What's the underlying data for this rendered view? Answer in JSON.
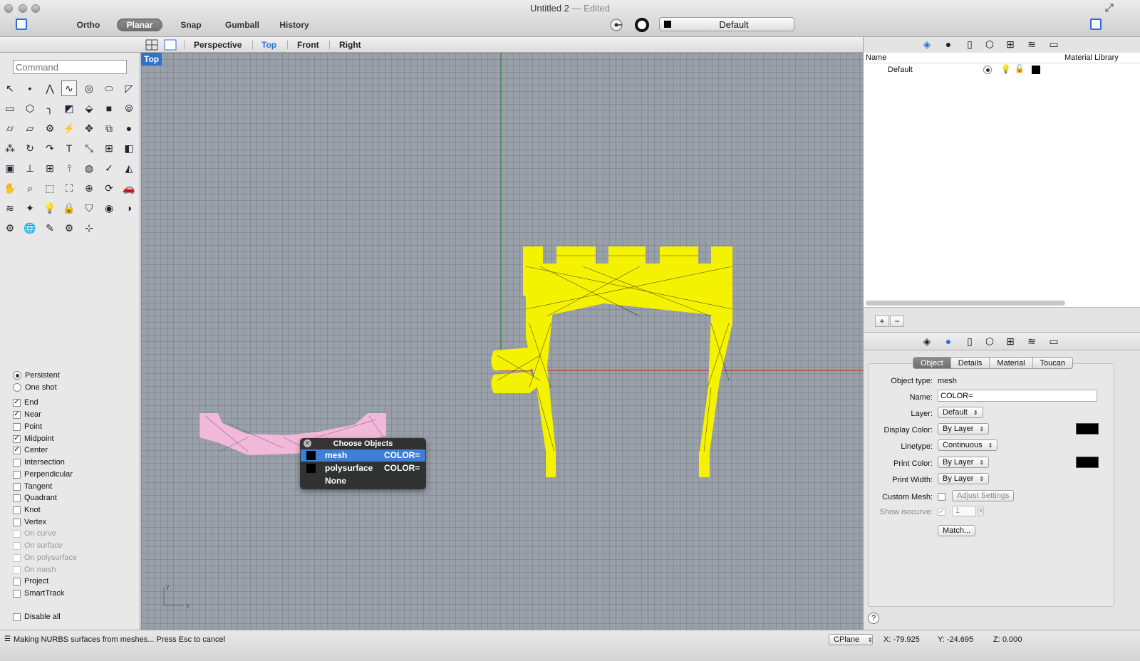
{
  "window": {
    "title": "Untitled 2",
    "edited": "— Edited"
  },
  "toolbar": {
    "ortho": "Ortho",
    "planar": "Planar",
    "snap": "Snap",
    "gumball": "Gumball",
    "history": "History",
    "layer": "Default"
  },
  "viewport_tabs": {
    "perspective": "Perspective",
    "top": "Top",
    "front": "Front",
    "right": "Right"
  },
  "command": {
    "placeholder": "Command"
  },
  "viewport": {
    "label": "Top",
    "axis_y": "y",
    "axis_x": "x"
  },
  "osnaps": {
    "persistent": "Persistent",
    "one_shot": "One shot",
    "end": "End",
    "near": "Near",
    "point": "Point",
    "midpoint": "Midpoint",
    "center": "Center",
    "intersection": "Intersection",
    "perpendicular": "Perpendicular",
    "tangent": "Tangent",
    "quadrant": "Quadrant",
    "knot": "Knot",
    "vertex": "Vertex",
    "on_curve": "On curve",
    "on_surface": "On surface",
    "on_polysurface": "On polysurface",
    "on_mesh": "On mesh",
    "project": "Project",
    "smarttrack": "SmartTrack",
    "disable_all": "Disable all"
  },
  "choose_objects": {
    "title": "Choose Objects",
    "items": [
      {
        "name": "mesh",
        "color": "COLOR="
      },
      {
        "name": "polysurface",
        "color": "COLOR="
      },
      {
        "name": "None",
        "color": ""
      }
    ]
  },
  "layers": {
    "col_name": "Name",
    "col_material": "Material Library",
    "row": "Default",
    "add": "+",
    "remove": "−"
  },
  "properties": {
    "tabs": [
      "Object",
      "Details",
      "Material",
      "Toucan"
    ],
    "object_type_label": "Object type:",
    "object_type": "mesh",
    "name_label": "Name:",
    "name": "COLOR=",
    "layer_label": "Layer:",
    "layer": "Default",
    "display_color_label": "Display Color:",
    "display_color": "By Layer",
    "linetype_label": "Linetype:",
    "linetype": "Continuous",
    "print_color_label": "Print Color:",
    "print_color": "By Layer",
    "print_width_label": "Print Width:",
    "print_width": "By Layer",
    "custom_mesh_label": "Custom Mesh:",
    "adjust_settings": "Adjust Settings",
    "show_isocurve_label": "Show isocurve:",
    "isocurve_value": "1",
    "match": "Match...",
    "help": "?"
  },
  "status": {
    "message": "Making NURBS surfaces from meshes... Press Esc to cancel",
    "cplane": "CPlane",
    "x": "X: -79.925",
    "y": "Y: -24.695",
    "z": "Z: 0.000"
  },
  "colors": {
    "accent": "#2a6fdb",
    "selected_mesh": "#f5f200",
    "pink_mesh": "#f2b8da",
    "axis_x": "#c0392b",
    "axis_y": "#2e8b3a"
  }
}
